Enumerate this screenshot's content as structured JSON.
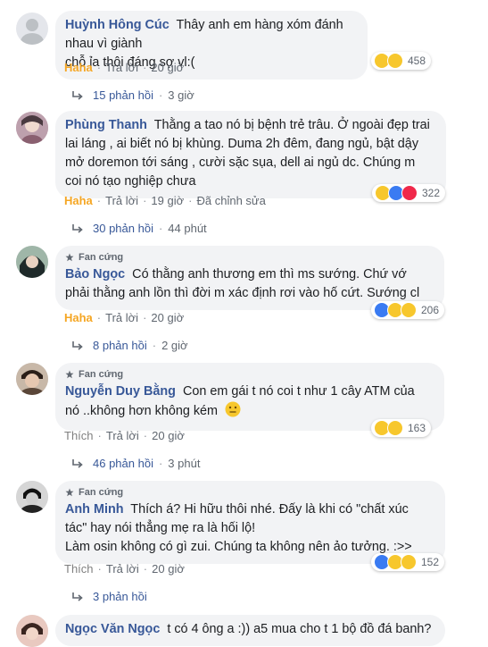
{
  "badge_label": "Fan cứng",
  "sep": "·",
  "comments": [
    {
      "name": "Huỳnh Hông Cúc",
      "lines": [
        "Thây anh em hàng xóm đánh nhau vì giành",
        "chỗ ỉa thôi đáng sợ vl:("
      ],
      "reaction_count": "458",
      "reactions": [
        "haha",
        "sad"
      ],
      "action_react": "Haha",
      "reply": "Trả lời",
      "time": "20 giờ",
      "edited": "",
      "replies_count": "15 phản hồi",
      "replies_time": "3 giờ"
    },
    {
      "name": "Phùng Thanh",
      "lines": [
        "Thằng a tao nó bị bệnh trẻ trâu. Ở ngoài đẹp trai",
        "lai láng , ai biết nó bị khùng. Duma 2h đêm, đang ngủ, bật dậy",
        "mở doremon tới sáng , cười sặc sụa, dell ai ngủ dc. Chúng m",
        "coi nó tạo nghiệp chưa"
      ],
      "reaction_count": "322",
      "reactions": [
        "haha",
        "like",
        "love"
      ],
      "action_react": "Haha",
      "reply": "Trả lời",
      "time": "19 giờ",
      "edited": "Đã chỉnh sửa",
      "replies_count": "30 phản hồi",
      "replies_time": "44 phút"
    },
    {
      "name": "Bảo Ngọc",
      "lines": [
        "Có thằng anh thương em thì ms sướng. Chứ vớ",
        "phải thằng anh lồn thì đời m xác định rơi vào hố cứt. Sướng cl"
      ],
      "reaction_count": "206",
      "reactions": [
        "like",
        "haha",
        "sad"
      ],
      "action_react": "Haha",
      "reply": "Trả lời",
      "time": "20 giờ",
      "edited": "",
      "replies_count": "8 phản hồi",
      "replies_time": "2 giờ"
    },
    {
      "name": "Nguyễn Duy Bằng",
      "lines": [
        "Con em gái t nó coi t như 1 cây ATM của",
        "nó ..không hơn không kém"
      ],
      "reaction_count": "163",
      "reactions": [
        "haha",
        "sad"
      ],
      "action_react": "Thích",
      "reply": "Trả lời",
      "time": "20 giờ",
      "edited": "",
      "replies_count": "46 phản hồi",
      "replies_time": "3 phút"
    },
    {
      "name": "Anh Minh",
      "lines": [
        "Thích á? Hi hữu thôi nhé. Đấy là khi có \"chất xúc",
        "tác\" hay nói thẳng mẹ ra là hối lộ!",
        "Làm osin không có gì zui. Chúng ta không nên ảo tưởng. :>>"
      ],
      "reaction_count": "152",
      "reactions": [
        "like",
        "haha",
        "sad"
      ],
      "action_react": "Thích",
      "reply": "Trả lời",
      "time": "20 giờ",
      "edited": "",
      "replies_count": "3 phản hồi",
      "replies_time": ""
    },
    {
      "name": "Ngọc Văn Ngọc",
      "lines": [
        "t có 4 ông a :)) a5 mua cho t 1 bộ đồ đá banh?"
      ]
    }
  ]
}
